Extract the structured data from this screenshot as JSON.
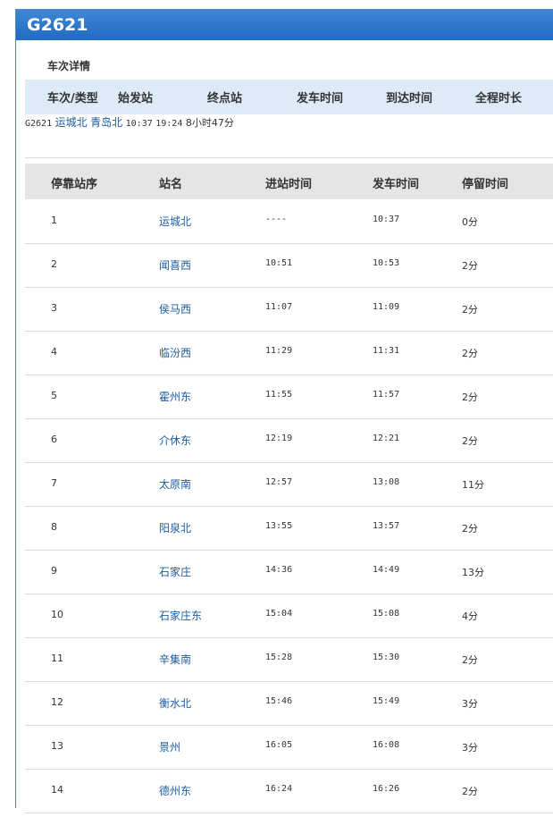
{
  "title": "G2621",
  "section_title": "车次详情",
  "summary": {
    "headers": [
      "车次/类型",
      "始发站",
      "终点站",
      "发车时间",
      "到达时间",
      "全程时长"
    ],
    "values": {
      "train": "G2621",
      "origin": "运城北",
      "terminal": "青岛北",
      "depart": "10:37",
      "arrive": "19:24",
      "duration": "8小时47分"
    }
  },
  "stops": {
    "headers": [
      "停靠站序",
      "站名",
      "进站时间",
      "发车时间",
      "停留时间"
    ],
    "rows": [
      {
        "seq": "1",
        "station": "运城北",
        "arrive": "----",
        "depart": "10:37",
        "stay": "0分"
      },
      {
        "seq": "2",
        "station": "闻喜西",
        "arrive": "10:51",
        "depart": "10:53",
        "stay": "2分"
      },
      {
        "seq": "3",
        "station": "侯马西",
        "arrive": "11:07",
        "depart": "11:09",
        "stay": "2分"
      },
      {
        "seq": "4",
        "station": "临汾西",
        "arrive": "11:29",
        "depart": "11:31",
        "stay": "2分"
      },
      {
        "seq": "5",
        "station": "霍州东",
        "arrive": "11:55",
        "depart": "11:57",
        "stay": "2分"
      },
      {
        "seq": "6",
        "station": "介休东",
        "arrive": "12:19",
        "depart": "12:21",
        "stay": "2分"
      },
      {
        "seq": "7",
        "station": "太原南",
        "arrive": "12:57",
        "depart": "13:08",
        "stay": "11分"
      },
      {
        "seq": "8",
        "station": "阳泉北",
        "arrive": "13:55",
        "depart": "13:57",
        "stay": "2分"
      },
      {
        "seq": "9",
        "station": "石家庄",
        "arrive": "14:36",
        "depart": "14:49",
        "stay": "13分"
      },
      {
        "seq": "10",
        "station": "石家庄东",
        "arrive": "15:04",
        "depart": "15:08",
        "stay": "4分"
      },
      {
        "seq": "11",
        "station": "辛集南",
        "arrive": "15:28",
        "depart": "15:30",
        "stay": "2分"
      },
      {
        "seq": "12",
        "station": "衡水北",
        "arrive": "15:46",
        "depart": "15:49",
        "stay": "3分"
      },
      {
        "seq": "13",
        "station": "景州",
        "arrive": "16:05",
        "depart": "16:08",
        "stay": "3分"
      },
      {
        "seq": "14",
        "station": "德州东",
        "arrive": "16:24",
        "depart": "16:26",
        "stay": "2分"
      }
    ]
  }
}
